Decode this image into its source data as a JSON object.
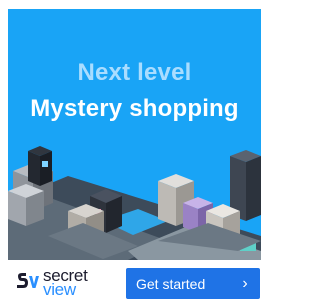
{
  "ad": {
    "headline_line1": "Next level",
    "headline_line2": "Mystery shopping",
    "brand_word_1": "secret",
    "brand_word_2": "view",
    "cta_label": "Get started",
    "cta_icon": "chevron-right-icon"
  },
  "colors": {
    "hero_background": "#19a4f6",
    "headline_accent": "#a9ddff",
    "cta_background": "#1f73e6",
    "brand_accent": "#2a8fff"
  }
}
